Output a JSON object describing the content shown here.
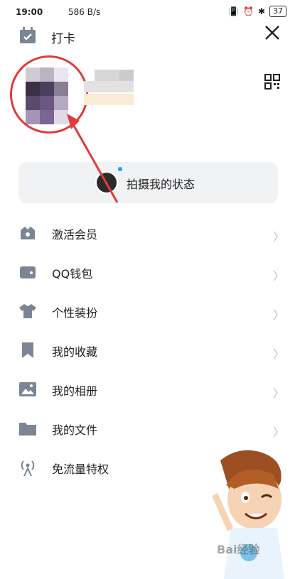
{
  "status_bar": {
    "time": "19:00",
    "network_speed": "586 B/s",
    "battery": "37"
  },
  "header": {
    "title": "打卡"
  },
  "status_button": {
    "label": "拍摄我的状态"
  },
  "menu": {
    "items": [
      {
        "label": "激活会员",
        "icon": "vip-crown-icon",
        "has_chevron": true
      },
      {
        "label": "QQ钱包",
        "icon": "wallet-icon",
        "has_chevron": true
      },
      {
        "label": "个性装扮",
        "icon": "tshirt-icon",
        "has_chevron": true
      },
      {
        "label": "我的收藏",
        "icon": "bookmark-icon",
        "has_chevron": true
      },
      {
        "label": "我的相册",
        "icon": "photo-album-icon",
        "has_chevron": true
      },
      {
        "label": "我的文件",
        "icon": "folder-icon",
        "has_chevron": true
      },
      {
        "label": "免流量特权",
        "icon": "signal-tower-icon",
        "has_chevron": false
      }
    ]
  },
  "watermark": {
    "text": "Bai经验"
  },
  "colors": {
    "icon_gray": "#7c8594",
    "annotation_red": "#e23a3a",
    "status_bg": "#f1f2f4",
    "chevron": "#b8bcc4"
  }
}
